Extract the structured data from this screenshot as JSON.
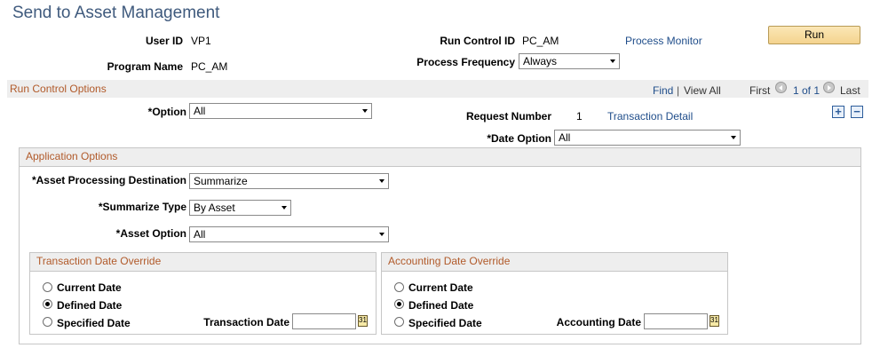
{
  "page": {
    "title": "Send to Asset Management"
  },
  "header": {
    "user_id_label": "User ID",
    "user_id": "VP1",
    "program_name_label": "Program Name",
    "program_name": "PC_AM",
    "run_control_label": "Run Control ID",
    "run_control": "PC_AM",
    "process_monitor": "Process Monitor",
    "run_button": "Run",
    "process_frequency_label": "Process Frequency",
    "process_frequency": "Always"
  },
  "run_control_options": {
    "title": "Run Control Options",
    "find": "Find",
    "separator": "|",
    "view_all": "View All",
    "first": "First",
    "page_info": "1 of 1",
    "last": "Last",
    "add": "+",
    "remove": "−",
    "option_label": "*Option",
    "option": "All",
    "request_number_label": "Request Number",
    "request_number": "1",
    "transaction_detail": "Transaction Detail",
    "date_option_label": "*Date Option",
    "date_option": "All"
  },
  "application_options": {
    "title": "Application Options",
    "asset_dest_label": "*Asset Processing Destination",
    "asset_dest": "Summarize",
    "summarize_type_label": "*Summarize Type",
    "summarize_type": "By Asset",
    "asset_option_label": "*Asset Option",
    "asset_option": "All"
  },
  "transaction_override": {
    "title": "Transaction Date Override",
    "current": "Current Date",
    "defined": "Defined Date",
    "specified": "Specified Date",
    "date_label": "Transaction Date",
    "date_value": "",
    "selected": "defined"
  },
  "accounting_override": {
    "title": "Accounting Date Override",
    "current": "Current Date",
    "defined": "Defined Date",
    "specified": "Specified Date",
    "date_label": "Accounting Date",
    "date_value": "",
    "selected": "defined"
  }
}
